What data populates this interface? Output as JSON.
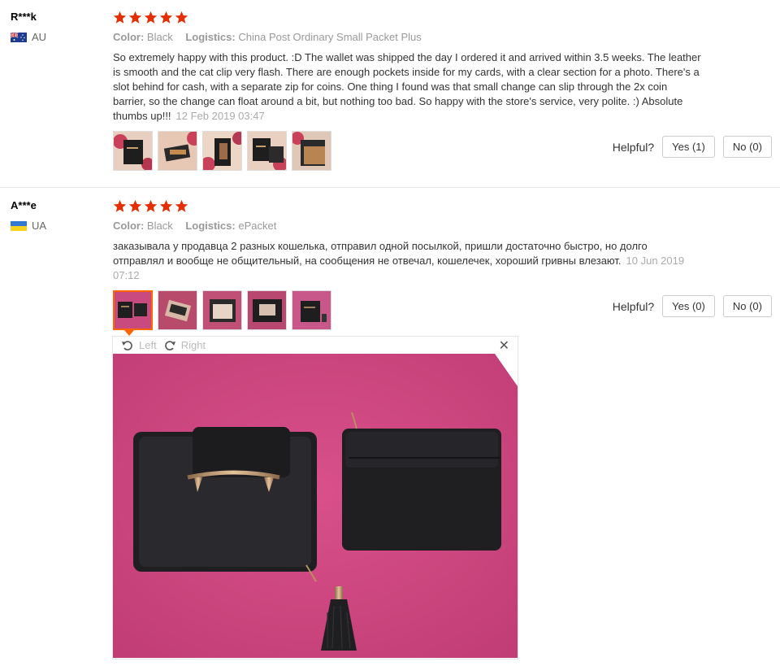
{
  "reviews": [
    {
      "user": "R***k",
      "country": "AU",
      "rating": 5,
      "color_label": "Color:",
      "color_value": "Black",
      "logistics_label": "Logistics:",
      "logistics_value": "China Post Ordinary Small Packet Plus",
      "text": "So extremely happy with this product. :D The wallet was shipped the day I ordered it and arrived within 3.5 weeks. The leather is smooth and the cat clip very flash. There are enough pockets inside for my cards, with a clear section for a photo. There's a slot behind for cash, with a separate zip for coins. One thing I found was that small change can slip through the 2x coin barrier, so the change can float around a bit, but nothing too bad. So happy with the store's service, very polite. :) Absolute thumbs up!!!",
      "date": "12 Feb 2019 03:47",
      "helpful_label": "Helpful?",
      "yes_label": "Yes (1)",
      "no_label": "No (0)"
    },
    {
      "user": "A***e",
      "country": "UA",
      "rating": 5,
      "color_label": "Color:",
      "color_value": "Black",
      "logistics_label": "Logistics:",
      "logistics_value": "ePacket",
      "text": "заказывала у продавца 2 разных кошелька, отправил одной посылкой, пришли достаточно быстро, но долго отправлял и вообще не общительный, на сообщения не отвечал, кошелечек, хороший гривны влезают.",
      "date": "10 Jun 2019 07:12",
      "helpful_label": "Helpful?",
      "yes_label": "Yes (0)",
      "no_label": "No (0)"
    }
  ],
  "viewer": {
    "rotate_left_label": "Left",
    "rotate_right_label": "Right",
    "close_icon": "close-icon"
  },
  "colors": {
    "star": "#e62e04",
    "active_thumb_border": "#ff6600",
    "viewer_bg": "#d4447f"
  }
}
